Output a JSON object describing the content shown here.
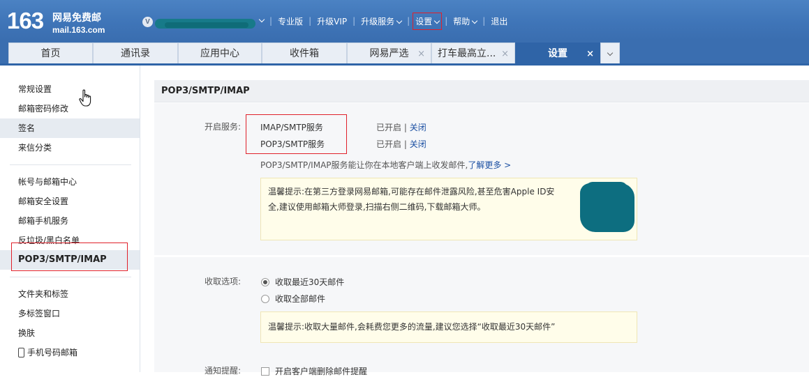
{
  "header": {
    "logo_number": "163",
    "logo_name": "网易免费邮",
    "logo_url": "mail.163.com",
    "vip_badge": "V",
    "nav": [
      "专业版",
      "升级VIP",
      "升级服务",
      "设置",
      "帮助",
      "退出"
    ]
  },
  "tabs": [
    {
      "label": "首页",
      "active": false
    },
    {
      "label": "通讯录",
      "active": false
    },
    {
      "label": "应用中心",
      "active": false
    },
    {
      "label": "收件箱",
      "active": false
    },
    {
      "label": "网易严选",
      "active": false
    },
    {
      "label": "打车最高立...",
      "active": false
    },
    {
      "label": "设置",
      "active": true
    }
  ],
  "tab_close_glyph": "×",
  "sidebar": {
    "group1": [
      "常规设置",
      "邮箱密码修改",
      "签名",
      "来信分类"
    ],
    "group2": [
      "帐号与邮箱中心",
      "邮箱安全设置",
      "邮箱手机服务",
      "反垃圾/黑白名单",
      "POP3/SMTP/IMAP"
    ],
    "group3": [
      "文件夹和标签",
      "多标签窗口",
      "换肤",
      "手机号码邮箱"
    ]
  },
  "main": {
    "title": "POP3/SMTP/IMAP",
    "service_label": "开启服务:",
    "services": [
      {
        "name": "IMAP/SMTP服务",
        "status": "已开启",
        "sep": "|",
        "action": "关闭"
      },
      {
        "name": "POP3/SMTP服务",
        "status": "已开启",
        "sep": "|",
        "action": "关闭"
      }
    ],
    "service_desc": "POP3/SMTP/IMAP服务能让你在本地客户端上收发邮件,",
    "learn_more": "了解更多 >",
    "tip1_line1": "温馨提示:在第三方登录网易邮箱,可能存在邮件泄露风险,甚至危害Apple ID安",
    "tip1_line2": "全,建议使用邮箱大师登录,扫描右侧二维码,下载邮箱大师。",
    "receive_label": "收取选项:",
    "receive_options": [
      {
        "label": "收取最近30天邮件",
        "checked": true
      },
      {
        "label": "收取全部邮件",
        "checked": false
      }
    ],
    "tip2": "温馨提示:收取大量邮件,会耗费您更多的流量,建议您选择“收取最近30天邮件”",
    "notify_label": "通知提醒:",
    "notify_option": "开启客户端删除邮件提醒"
  },
  "colors": {
    "header_blue": "#3f75b8",
    "active_tab": "#2f64a7",
    "highlight_red": "#e0202a",
    "link": "#1b4fa2",
    "tip_bg": "#fffdea"
  },
  "icons": [
    "vip-badge-icon",
    "chevron-down-icon",
    "close-icon",
    "hand-cursor-icon",
    "phone-icon",
    "qr-code-image"
  ]
}
